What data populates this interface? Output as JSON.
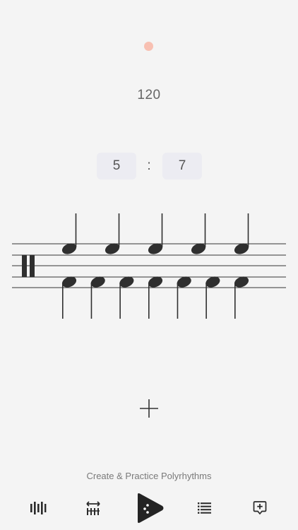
{
  "colors": {
    "accent_dot": "#f8c0b2",
    "note": "#2f2f2f",
    "staff_line": "#333333",
    "play_button": "#232323"
  },
  "tempo": {
    "bpm": "120"
  },
  "ratio": {
    "left": "5",
    "separator": ":",
    "right": "7"
  },
  "staff": {
    "upper_voice_note_count": 5,
    "lower_voice_note_count": 7,
    "clef": "percussion"
  },
  "add_button": {
    "icon": "plus-icon"
  },
  "tagline": "Create & Practice Polyrhythms",
  "tab_bar": {
    "items": [
      {
        "name": "metronome-tab",
        "icon": "vertical-bars-icon"
      },
      {
        "name": "tempo-tab",
        "icon": "tempo-arrows-icon"
      },
      {
        "name": "play-tab",
        "icon": "play-icon"
      },
      {
        "name": "list-tab",
        "icon": "list-icon"
      },
      {
        "name": "add-tab",
        "icon": "add-bubble-icon"
      }
    ]
  }
}
